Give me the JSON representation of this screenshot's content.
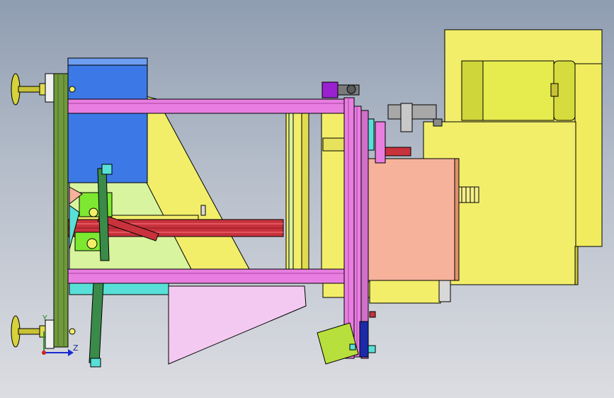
{
  "view": {
    "triad": {
      "z_label": "Z",
      "y_label": "Y"
    },
    "colors": {
      "frame_pink": "#e87ee0",
      "frame_pink_dark": "#b040a8",
      "yellow": "#f2ee6a",
      "yellow_dark": "#c8c236",
      "blue": "#3c78e6",
      "olive": "#6f9a3c",
      "salmon": "#f6b29a",
      "red_rail": "#c8323c",
      "light_green": "#d8f49e",
      "cyan": "#58e0d8",
      "lavender": "#f3c9f1",
      "purple": "#9a20d0",
      "gray": "#a5a5a5"
    }
  }
}
